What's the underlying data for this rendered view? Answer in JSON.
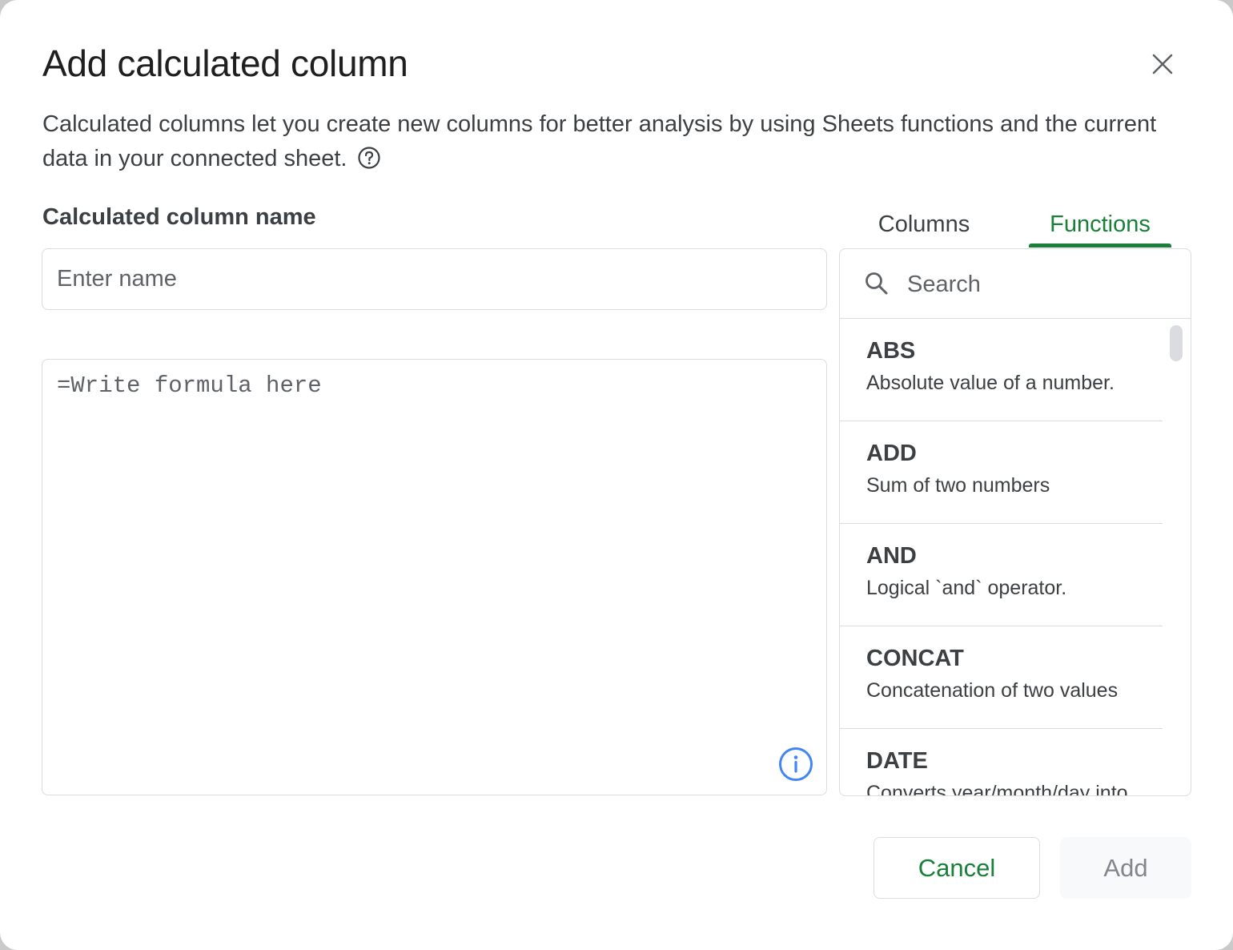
{
  "dialog": {
    "title": "Add calculated column",
    "description": "Calculated columns let you create new columns for better analysis by using Sheets functions and the current data in your connected sheet.",
    "close_icon": "close-icon",
    "help_icon": "help-circle-icon"
  },
  "name_field": {
    "label": "Calculated column name",
    "placeholder": "Enter name",
    "value": ""
  },
  "formula_field": {
    "placeholder": "=Write formula here",
    "value": "",
    "info_icon": "info-icon"
  },
  "tabs": [
    {
      "label": "Columns",
      "active": false
    },
    {
      "label": "Functions",
      "active": true
    }
  ],
  "functions_panel": {
    "search_placeholder": "Search",
    "search_icon": "search-icon",
    "items": [
      {
        "name": "ABS",
        "desc": "Absolute value of a number."
      },
      {
        "name": "ADD",
        "desc": "Sum of two numbers"
      },
      {
        "name": "AND",
        "desc": "Logical `and` operator."
      },
      {
        "name": "CONCAT",
        "desc": "Concatenation of two values"
      },
      {
        "name": "DATE",
        "desc": "Converts year/month/day into"
      }
    ]
  },
  "footer": {
    "cancel_label": "Cancel",
    "add_label": "Add"
  },
  "colors": {
    "accent_green": "#188038",
    "border": "#dadce0",
    "info_blue": "#4285f4",
    "text": "#3c4043"
  }
}
